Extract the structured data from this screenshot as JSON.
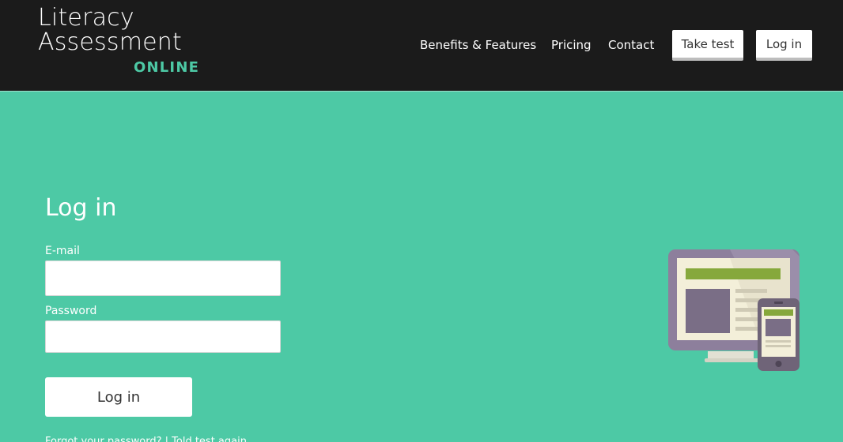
{
  "header": {
    "logo": {
      "line1": "Literacy",
      "line2": "Assessment",
      "line3": "ONLINE"
    },
    "nav": {
      "benefits": "Benefits & Features",
      "pricing": "Pricing",
      "contact": "Contact",
      "take_test": "Take test",
      "log_in": "Log in"
    }
  },
  "form": {
    "title": "Log in",
    "email_label": "E-mail",
    "email_value": "",
    "password_label": "Password",
    "password_value": "",
    "submit_label": "Log in",
    "footer_text": "Forgot your password? | Told test again"
  },
  "colors": {
    "accent": "#4dc9a5",
    "header_bg": "#1b1b1b"
  },
  "illustration": {
    "icon": "desktop-and-phone-icon"
  }
}
